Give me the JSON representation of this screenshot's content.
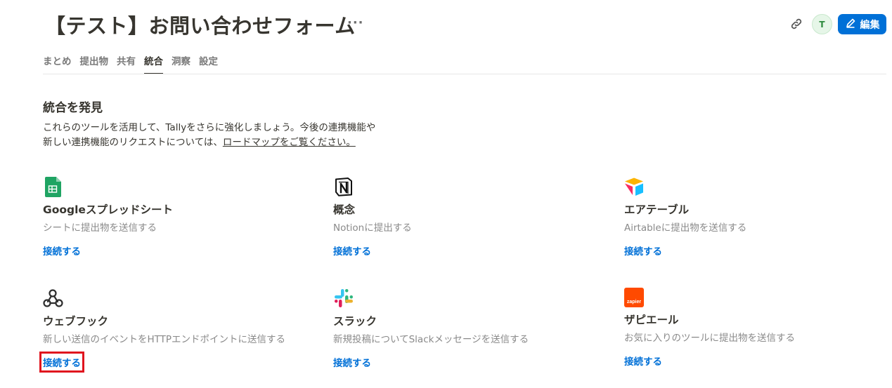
{
  "header": {
    "title": "【テスト】お問い合わせフォーム",
    "more": "···",
    "avatar_initial": "T",
    "edit_label": "編集",
    "accent_color": "#0070d7"
  },
  "tabs": [
    {
      "label": "まとめ",
      "active": false
    },
    {
      "label": "提出物",
      "active": false
    },
    {
      "label": "共有",
      "active": false
    },
    {
      "label": "統合",
      "active": true
    },
    {
      "label": "洞察",
      "active": false
    },
    {
      "label": "設定",
      "active": false
    }
  ],
  "main": {
    "section_title": "統合を発見",
    "desc_line1": "これらのツールを活用して、Tallyをさらに強化しましょう。今後の連携機能や",
    "desc_line2_prefix": "新しい連携機能のリクエストについては、",
    "desc_link": "ロードマップをご覧ください。"
  },
  "integrations": [
    {
      "icon": "google-sheets-icon",
      "name": "Googleスプレッドシート",
      "desc": "シートに提出物を送信する",
      "connect": "接続する"
    },
    {
      "icon": "notion-icon",
      "name": "概念",
      "desc": "Notionに提出する",
      "connect": "接続する"
    },
    {
      "icon": "airtable-icon",
      "name": "エアテーブル",
      "desc": "Airtableに提出物を送信する",
      "connect": "接続する"
    },
    {
      "icon": "webhook-icon",
      "name": "ウェブフック",
      "desc": "新しい送信のイベントをHTTPエンドポイントに送信する",
      "connect": "接続する",
      "highlighted": true
    },
    {
      "icon": "slack-icon",
      "name": "スラック",
      "desc": "新規投稿についてSlackメッセージを送信する",
      "connect": "接続する"
    },
    {
      "icon": "zapier-icon",
      "name": "ザピエール",
      "desc": "お気に入りのツールに提出物を送信する",
      "connect": "接続する",
      "icon_text": "zapier"
    }
  ],
  "colors": {
    "highlight": "#e0141e",
    "link": "#0070d7"
  }
}
